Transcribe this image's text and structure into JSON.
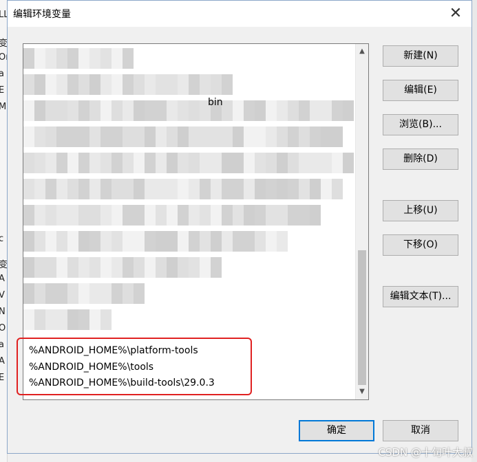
{
  "dialog": {
    "title": "编辑环境变量",
    "close_glyph": "✕"
  },
  "path_list": {
    "visible_entries": [
      "%ANDROID_HOME%\\platform-tools",
      "%ANDROID_HOME%\\tools",
      "%ANDROID_HOME%\\build-tools\\29.0.3"
    ],
    "partial_text": "bin"
  },
  "buttons": {
    "new": "新建(N)",
    "edit": "编辑(E)",
    "browse": "浏览(B)...",
    "delete": "删除(D)",
    "move_up": "上移(U)",
    "move_down": "下移(O)",
    "edit_text": "编辑文本(T)...",
    "ok": "确定",
    "cancel": "取消"
  },
  "background_fragments": [
    "LL",
    "变",
    "Or",
    "a",
    "E",
    "M",
    "变",
    "A",
    "V",
    "N",
    "O",
    "a",
    "A",
    "E",
    "c"
  ],
  "watermark": "CSDN @十旬叶大叔",
  "colors": {
    "highlight": "#e02020",
    "primary_border": "#0078d7"
  }
}
